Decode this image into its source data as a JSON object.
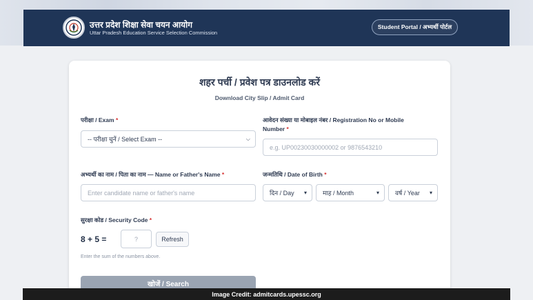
{
  "header": {
    "org_name_hi": "उत्तर प्रदेश शिक्षा सेवा चयन आयोग",
    "org_name_en": "Uttar Pradesh Education Service Selection Commission",
    "portal_button": "Student Portal / अभ्यर्थी पोर्टल"
  },
  "form": {
    "title": "शहर पर्ची / प्रवेश पत्र डाउनलोड करें",
    "subtitle": "Download City Slip / Admit Card",
    "exam": {
      "label": "परीक्षा / Exam",
      "required_mark": "*",
      "selected": "-- परीक्षा चुनें / Select Exam --"
    },
    "registration": {
      "label_line1": "आवेदन संख्या या मोबाइल नंबर / Registration No or Mobile",
      "label_line2": "Number",
      "required_mark": "*",
      "placeholder": "e.g. UP00230030000002 or 9876543210"
    },
    "name": {
      "label": "अभ्यर्थी का नाम / पिता का नाम — Name or Father's Name",
      "required_mark": "*",
      "placeholder": "Enter candidate name or father's name"
    },
    "dob": {
      "label": "जन्मतिथि / Date of Birth",
      "required_mark": "*",
      "day": "दिन / Day",
      "month": "माह / Month",
      "year": "वर्ष / Year"
    },
    "security": {
      "label": "सुरक्षा कोड / Security Code",
      "required_mark": "*",
      "question": "8 + 5 =",
      "input_placeholder": "?",
      "refresh_label": "Refresh",
      "hint": "Enter the sum of the numbers above."
    },
    "search_button": "खोजें / Search"
  },
  "caption": "Image Credit: admitcards.upessc.org",
  "colors": {
    "header_bg": "#1f3557",
    "required": "#d62f2f",
    "search_button_bg": "#9aa4b2"
  }
}
